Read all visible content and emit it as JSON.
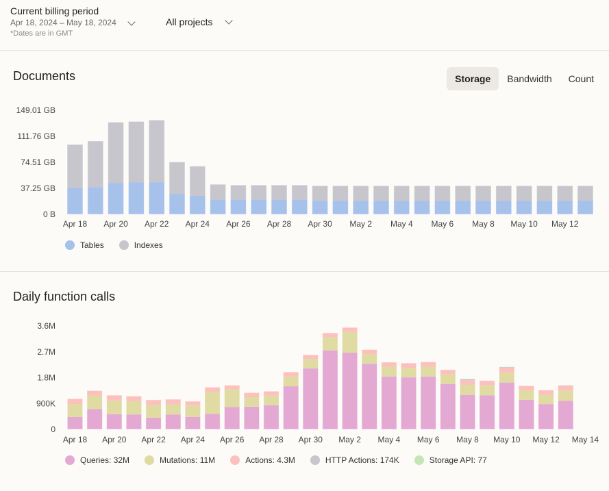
{
  "header": {
    "period_title": "Current billing period",
    "period_range": "Apr 18, 2024 – May 18, 2024",
    "period_note": "*Dates are in GMT",
    "project_selector": "All projects"
  },
  "documents": {
    "title": "Documents",
    "tabs": [
      {
        "label": "Storage",
        "active": true
      },
      {
        "label": "Bandwidth",
        "active": false
      },
      {
        "label": "Count",
        "active": false
      }
    ]
  },
  "calls": {
    "title": "Daily function calls"
  },
  "chart_data": [
    {
      "type": "bar",
      "stacked": true,
      "title": "Documents",
      "ylabel": "Storage",
      "ylim": [
        0,
        149.01
      ],
      "yticks": [
        "0 B",
        "37.25 GB",
        "74.51 GB",
        "111.76 GB",
        "149.01 GB"
      ],
      "ytick_values": [
        0,
        37.25,
        74.51,
        111.76,
        149.01
      ],
      "unit": "GB",
      "categories": [
        "Apr 18",
        "Apr 19",
        "Apr 20",
        "Apr 21",
        "Apr 22",
        "Apr 23",
        "Apr 24",
        "Apr 25",
        "Apr 26",
        "Apr 27",
        "Apr 28",
        "Apr 29",
        "Apr 30",
        "May 1",
        "May 2",
        "May 3",
        "May 4",
        "May 5",
        "May 6",
        "May 7",
        "May 8",
        "May 9",
        "May 10",
        "May 11",
        "May 12",
        "May 13"
      ],
      "xtick_labels": [
        "Apr 18",
        "Apr 20",
        "Apr 22",
        "Apr 24",
        "Apr 26",
        "Apr 28",
        "Apr 30",
        "May 2",
        "May 4",
        "May 6",
        "May 8",
        "May 10",
        "May 12"
      ],
      "series": [
        {
          "name": "Tables",
          "color": "#a6c1ea",
          "values": [
            38,
            39,
            45,
            46,
            46,
            29,
            26.5,
            21,
            21,
            21,
            21,
            21,
            19.5,
            19.5,
            19.5,
            19.5,
            19.5,
            19.5,
            19.5,
            19.5,
            19.5,
            19.5,
            19.5,
            19.5,
            19.5,
            19.5
          ]
        },
        {
          "name": "Indexes",
          "color": "#c6c6cc",
          "values": [
            62,
            66,
            87,
            87,
            89,
            46,
            42.5,
            22,
            21,
            21,
            21,
            21,
            21.5,
            21.5,
            21.5,
            21.5,
            21.5,
            21.5,
            21.5,
            21.5,
            21.5,
            21.5,
            21.5,
            21.5,
            21.5,
            21.5
          ]
        }
      ],
      "legend": "bottom-left",
      "grid": false
    },
    {
      "type": "bar",
      "stacked": true,
      "title": "Daily function calls",
      "ylim": [
        0,
        3.6
      ],
      "unit": "M",
      "yticks": [
        "0",
        "900K",
        "1.8M",
        "2.7M",
        "3.6M"
      ],
      "ytick_values": [
        0,
        0.9,
        1.8,
        2.7,
        3.6
      ],
      "categories": [
        "Apr 18",
        "Apr 19",
        "Apr 20",
        "Apr 21",
        "Apr 22",
        "Apr 23",
        "Apr 24",
        "Apr 25",
        "Apr 26",
        "Apr 27",
        "Apr 28",
        "Apr 29",
        "Apr 30",
        "May 1",
        "May 2",
        "May 3",
        "May 4",
        "May 5",
        "May 6",
        "May 7",
        "May 8",
        "May 9",
        "May 10",
        "May 11",
        "May 12",
        "May 13"
      ],
      "xtick_labels": [
        "Apr 18",
        "Apr 20",
        "Apr 22",
        "Apr 24",
        "Apr 26",
        "Apr 28",
        "Apr 30",
        "May 2",
        "May 4",
        "May 6",
        "May 8",
        "May 10",
        "May 12",
        "May 14"
      ],
      "series": [
        {
          "name": "Queries",
          "legend_label": "Queries: 32M",
          "color": "#e3a9d3",
          "values": [
            0.43,
            0.71,
            0.53,
            0.52,
            0.41,
            0.52,
            0.43,
            0.54,
            0.78,
            0.79,
            0.84,
            1.5,
            2.12,
            2.75,
            2.67,
            2.28,
            1.84,
            1.81,
            1.84,
            1.58,
            1.2,
            1.18,
            1.63,
            1.03,
            0.88,
            0.99
          ]
        },
        {
          "name": "Mutations",
          "legend_label": "Mutations: 11M",
          "color": "#e0dba3",
          "values": [
            0.45,
            0.46,
            0.47,
            0.46,
            0.44,
            0.35,
            0.4,
            0.77,
            0.61,
            0.33,
            0.33,
            0.34,
            0.33,
            0.46,
            0.72,
            0.34,
            0.34,
            0.33,
            0.34,
            0.33,
            0.35,
            0.35,
            0.35,
            0.33,
            0.32,
            0.36
          ]
        },
        {
          "name": "Actions",
          "legend_label": "Actions: 4.3M",
          "color": "#fcc1bc",
          "values": [
            0.19,
            0.18,
            0.19,
            0.18,
            0.18,
            0.18,
            0.15,
            0.16,
            0.15,
            0.16,
            0.16,
            0.16,
            0.15,
            0.15,
            0.16,
            0.16,
            0.16,
            0.17,
            0.17,
            0.17,
            0.16,
            0.17,
            0.17,
            0.16,
            0.17,
            0.17
          ]
        },
        {
          "name": "HTTP Actions",
          "legend_label": "HTTP Actions: 174K",
          "color": "#c6c6cc",
          "values": [
            0,
            0,
            0,
            0,
            0,
            0,
            0,
            0,
            0,
            0,
            0,
            0,
            0,
            0,
            0,
            0,
            0,
            0,
            0,
            0,
            0.05,
            0,
            0.03,
            0,
            0,
            0.02
          ]
        },
        {
          "name": "Storage API",
          "legend_label": "Storage API: 77",
          "color": "#c4e6b4",
          "values": [
            0,
            0,
            0,
            0,
            0,
            0,
            0,
            0,
            0,
            0,
            0,
            0,
            0,
            0,
            0,
            0,
            0,
            0,
            0,
            0,
            0,
            0,
            0,
            0,
            0,
            0
          ]
        }
      ],
      "legend": "bottom-left",
      "grid": false
    }
  ]
}
